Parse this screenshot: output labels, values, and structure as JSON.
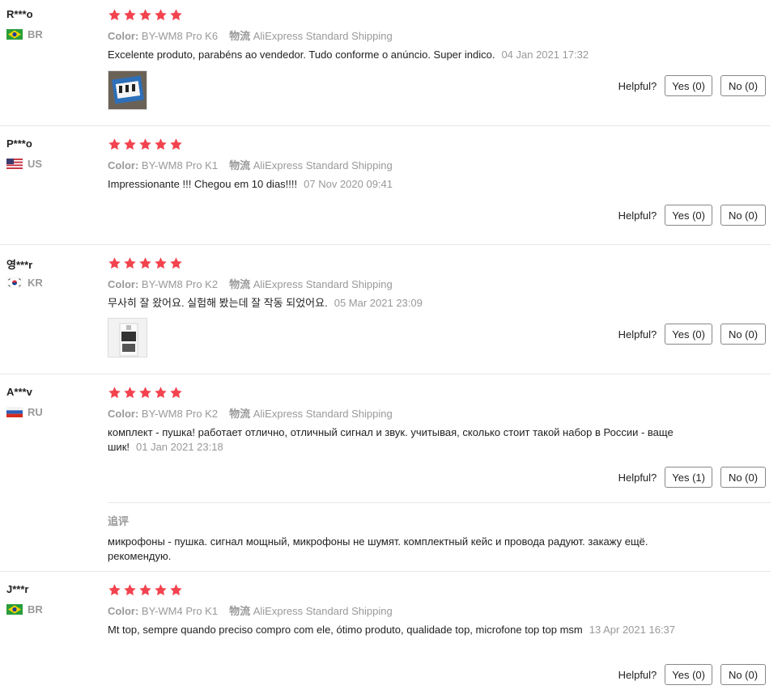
{
  "reviews": [
    {
      "user": "R***o",
      "country": "BR",
      "flag": "br",
      "color_label": "Color:",
      "color_value": "BY-WM8 Pro K6",
      "ship_label": "物流",
      "ship_value": "AliExpress Standard Shipping",
      "text": "Excelente produto, parabéns ao vendedor. Tudo conforme o anúncio. Super indico.",
      "date": "04 Jan 2021 17:32",
      "helpful_label": "Helpful?",
      "yes": "Yes (0)",
      "no": "No (0)"
    },
    {
      "user": "P***o",
      "country": "US",
      "flag": "us",
      "color_label": "Color:",
      "color_value": "BY-WM8 Pro K1",
      "ship_label": "物流",
      "ship_value": "AliExpress Standard Shipping",
      "text": "Impressionante !!! Chegou em 10 dias!!!!",
      "date": "07 Nov 2020 09:41",
      "helpful_label": "Helpful?",
      "yes": "Yes (0)",
      "no": "No (0)"
    },
    {
      "user": "영***r",
      "country": "KR",
      "flag": "kr",
      "color_label": "Color:",
      "color_value": "BY-WM8 Pro K2",
      "ship_label": "物流",
      "ship_value": "AliExpress Standard Shipping",
      "text": "무사히 잘 왔어요. 실험해 봤는데 잘 작동 되었어요.",
      "date": "05 Mar 2021 23:09",
      "helpful_label": "Helpful?",
      "yes": "Yes (0)",
      "no": "No (0)"
    },
    {
      "user": "A***v",
      "country": "RU",
      "flag": "ru",
      "color_label": "Color:",
      "color_value": "BY-WM8 Pro K2",
      "ship_label": "物流",
      "ship_value": "AliExpress Standard Shipping",
      "text": "комплект - пушка! работает отлично, отличный сигнал и звук. учитывая, сколько стоит такой набор в России - ваще шик!",
      "date": "01 Jan 2021 23:18",
      "helpful_label": "Helpful?",
      "yes": "Yes (1)",
      "no": "No (0)",
      "followup_title": "追评",
      "followup_text": "микрофоны - пушка. сигнал мощный, микрофоны не шумят. комплектный кейс и провода радуют. закажу ещё. рекомендую."
    },
    {
      "user": "J***r",
      "country": "BR",
      "flag": "br",
      "color_label": "Color:",
      "color_value": "BY-WM4 Pro K1",
      "ship_label": "物流",
      "ship_value": "AliExpress Standard Shipping",
      "text": "Mt top, sempre quando preciso compro com ele, ótimo produto, qualidade top, microfone top top msm",
      "date": "13 Apr 2021 16:37",
      "helpful_label": "Helpful?",
      "yes": "Yes (0)",
      "no": "No (0)"
    }
  ],
  "colors": {
    "star": "#f2434e",
    "muted": "#999999",
    "text": "#222222"
  }
}
